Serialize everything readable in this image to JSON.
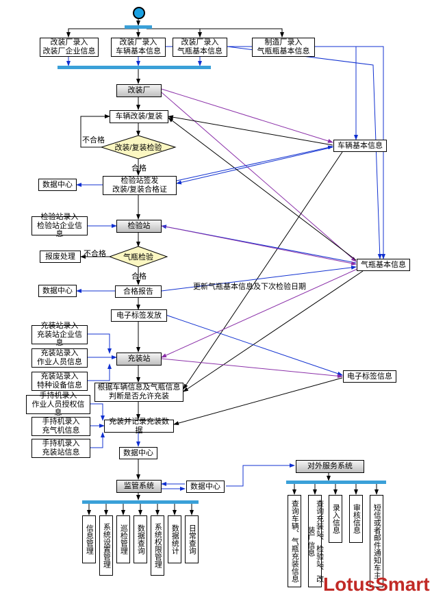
{
  "start": "start",
  "fork1": "fork",
  "fork2": "fork-2",
  "fork3": "fork-3",
  "fork4": "fork-4",
  "top_inputs": {
    "a": "改装厂录入\n改装厂企业信息",
    "b": "改装厂录入\n车辆基本信息",
    "c": "改装厂录入\n气瓶基本信息",
    "d": "制造厂录入\n气瓶瓶基本信息"
  },
  "factory": "改装厂",
  "vehicle_mod": "车辆改装/复装",
  "decision1": "改装/复装检验",
  "decision1_pass": "合格",
  "decision1_fail": "不合格",
  "cert_issue": "检验站签发\n改装/复装合格证",
  "datacenter1": "数据中心",
  "insp_enter": "检验站录入\n检验站企业信息",
  "inspection_station": "检验站",
  "decision2": "气瓶检验",
  "decision2_pass": "合格",
  "decision2_fail": "不合格",
  "scrap": "报废处理",
  "datacenter2": "数据中心",
  "qual_report": "合格报告",
  "etag_issue": "电子标签发放",
  "update_note": "更新气瓶基本信息及下次检验日期",
  "fill_inputs": {
    "a": "充装站录入\n充装站企业信息",
    "b": "充装站录入\n作业人员信息",
    "c": "充装站录入\n特种设备信息"
  },
  "fill_station": "充装站",
  "fill_check": "根据车辆信息及气瓶信息\n判断是否允许充装",
  "hand_inputs": {
    "a": "手持机录入\n作业人员授权信息",
    "b": "手持机录入\n充气机信息",
    "c": "手持机录入\n充装站信息"
  },
  "fill_record": "充装并记录充装数据",
  "datacenter3": "数据中心",
  "supervise": "监管系统",
  "datacenter4": "数据中心",
  "supervise_items": {
    "a": "信息管理",
    "b": "系统设置管理",
    "c": "巡检管理",
    "d": "数据查询",
    "e": "系统权限管理",
    "f": "数据统计",
    "g": "日常查询"
  },
  "ext_service": "对外服务系统",
  "ext_items": {
    "a": "查询车辆、气瓶充装信息",
    "b": "查询充装站、检验站、改装厂信息",
    "c": "录入信息",
    "d": "审核信息",
    "e": "短信或者邮件通知车主"
  },
  "right_boxes": {
    "vehicle": "车辆基本信息",
    "cylinder": "气瓶基本信息",
    "etag": "电子标签信息"
  },
  "watermark": "LotusSmart"
}
